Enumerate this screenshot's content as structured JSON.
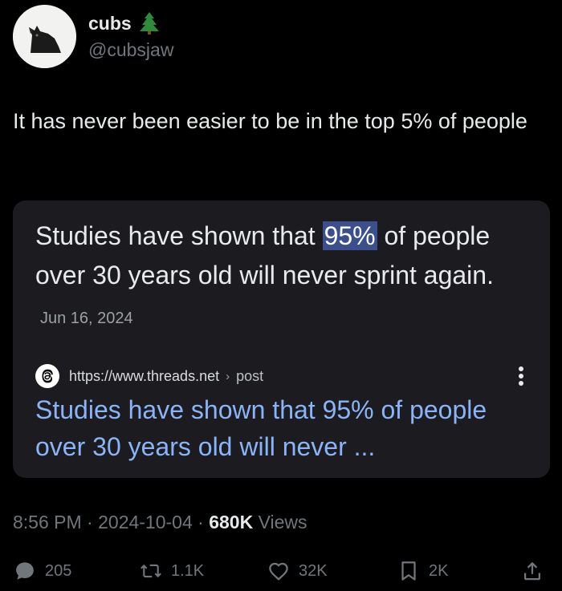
{
  "author": {
    "display_name": "cubs",
    "handle": "@cubsjaw",
    "name_emoji_icon": "evergreen-tree-icon"
  },
  "tweet": {
    "text": "It has never been easier to be in the top 5% of people"
  },
  "card": {
    "snippet_before": "Studies have shown that ",
    "snippet_highlight": "95%",
    "snippet_after": " of people over 30 years old will never sprint again.",
    "snippet_date": "Jun 16, 2024",
    "source_url": "https://www.threads.net",
    "source_separator": "›",
    "source_path": "post",
    "result_title": "Studies have shown that 95% of people over 30 years old will never ...",
    "highlight_color": "#3b4f8c",
    "link_color": "#8ab4f8"
  },
  "meta": {
    "time": "8:56 PM",
    "sep1": " · ",
    "date": "2024-10-04",
    "sep2": " · ",
    "views_count": "680K",
    "views_label": " Views"
  },
  "actions": {
    "replies": "205",
    "reposts": "1.1K",
    "likes": "32K",
    "bookmarks": "2K"
  }
}
